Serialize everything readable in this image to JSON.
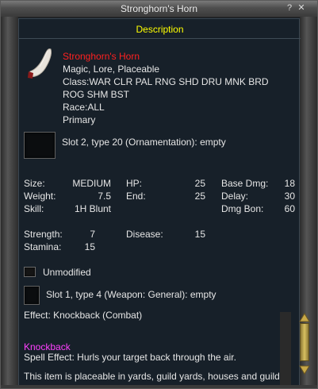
{
  "window": {
    "title": "Stronghorn's Horn"
  },
  "section": {
    "header": "Description"
  },
  "item": {
    "name": "Stronghorn's Horn",
    "flags": "Magic, Lore, Placeable",
    "class_line1": "Class:WAR CLR PAL RNG SHD DRU MNK BRD",
    "class_line2": "ROG SHM BST",
    "race": "Race:ALL",
    "slot": "Primary",
    "icon": "horn-icon"
  },
  "aug_slot_top": "Slot 2, type 20 (Ornamentation): empty",
  "stats": {
    "size_label": "Size:",
    "size_value": "MEDIUM",
    "weight_label": "Weight:",
    "weight_value": "7.5",
    "skill_label": "Skill:",
    "skill_value": "1H Blunt",
    "hp_label": "HP:",
    "hp_value": "25",
    "end_label": "End:",
    "end_value": "25",
    "base_dmg_label": "Base Dmg:",
    "base_dmg_value": "18",
    "delay_label": "Delay:",
    "delay_value": "30",
    "dmg_bon_label": "Dmg Bon:",
    "dmg_bon_value": "60",
    "strength_label": "Strength:",
    "strength_value": "7",
    "stamina_label": "Stamina:",
    "stamina_value": "15",
    "disease_label": "Disease:",
    "disease_value": "15"
  },
  "unmodified": "Unmodified",
  "aug_slot_bottom": "Slot 1, type 4 (Weapon: General): empty",
  "effect": "Effect: Knockback (Combat)",
  "spell": {
    "name": "Knockback",
    "effect": "Spell Effect: Hurls your target back through the air."
  },
  "placeable": "This item is placeable in yards, guild yards, houses and guild",
  "colors": {
    "header": "#ffff00",
    "item_name": "#ff2020",
    "spell_name": "#ff40ff"
  }
}
